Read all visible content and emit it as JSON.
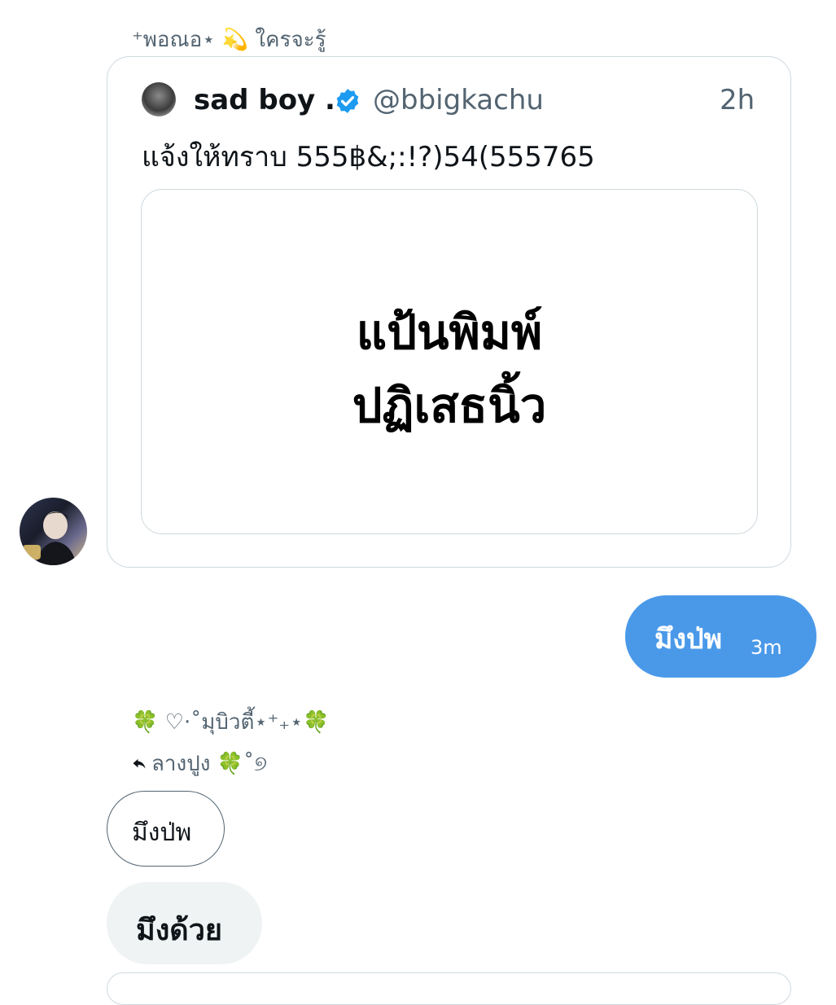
{
  "quoted_message": {
    "sender_name": "⁺พอณอ⋆ 💫 ใครจะรู้",
    "tweet": {
      "author_name": "sad boy .",
      "handle": "@bbigkachu",
      "time": "2h",
      "text": "แจ้งให้ทราบ 555฿&;:!?)54(555765",
      "media_lines": [
        "แป้นพิมพ์",
        "ปฏิเสธนิ้ว"
      ]
    }
  },
  "own_message": {
    "text": "มึงป่พ",
    "time": "3m"
  },
  "reply_message": {
    "sender_name": "🍀 ♡·˚มุบิวตี้⋆⁺₊⋆🍀",
    "reply_context": "ลางปูง 🍀˚୭",
    "quoted_text": "มึงป่พ",
    "text": "มึงด้วย"
  },
  "colors": {
    "own_bubble": "#4a99e9",
    "other_bubble": "#eff3f4",
    "secondary_text": "#536471",
    "border": "#cfd9de",
    "verified": "#1d9bf0"
  }
}
